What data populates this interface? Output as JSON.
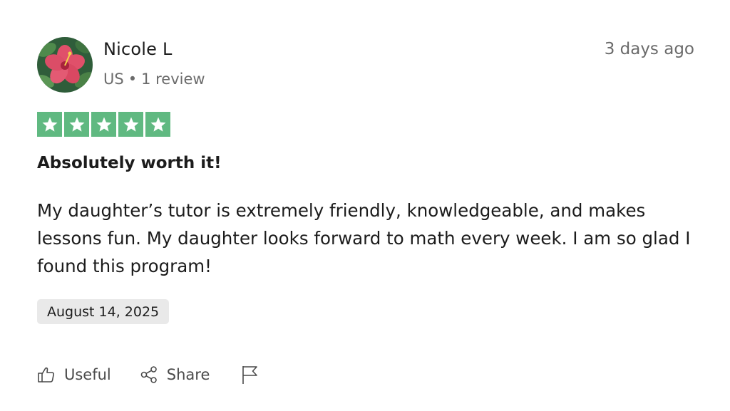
{
  "reviewer": {
    "name": "Nicole L",
    "country": "US",
    "separator": "•",
    "review_count": "1 review",
    "avatar_icon": "hibiscus-flower-avatar"
  },
  "review": {
    "posted_ago": "3 days ago",
    "rating": 5,
    "rating_max": 5,
    "star_color": "#60b981",
    "title": "Absolutely worth it!",
    "body": "My daughter’s tutor is extremely friendly, knowledgeable, and makes lessons fun. My daughter looks forward to math every week. I am so glad I found this program!",
    "date_of_experience": "August 14, 2025"
  },
  "actions": {
    "useful_label": "Useful",
    "useful_icon": "thumbs-up-icon",
    "share_label": "Share",
    "share_icon": "share-icon",
    "report_icon": "flag-icon"
  }
}
